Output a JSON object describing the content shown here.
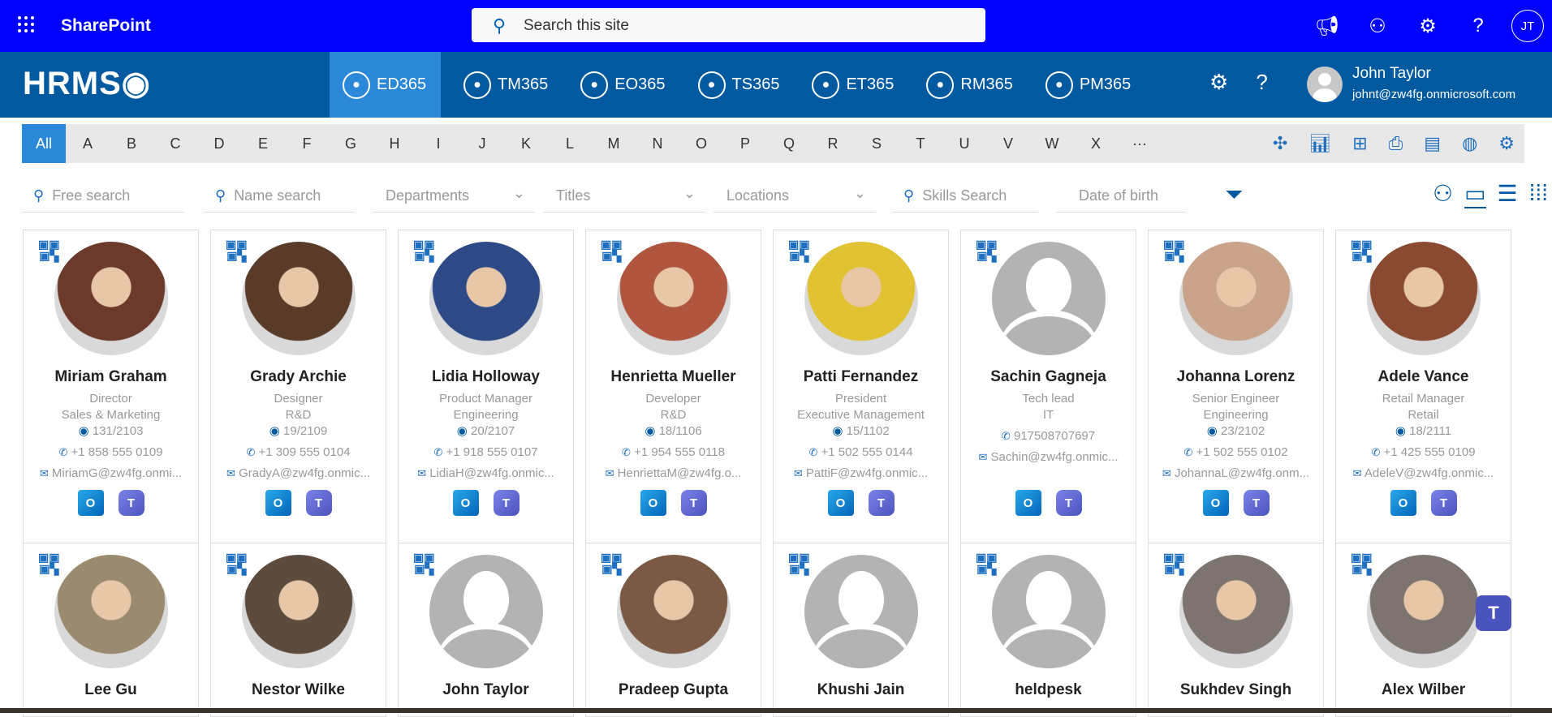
{
  "topbar": {
    "app_name": "SharePoint",
    "search_placeholder": "Search this site",
    "avatar_initials": "JT"
  },
  "hrms": {
    "logo": "HRMS",
    "apps": [
      {
        "label": "ED365",
        "icon": "directory-icon",
        "active": true
      },
      {
        "label": "TM365",
        "icon": "calendar-icon"
      },
      {
        "label": "EO365",
        "icon": "onboarding-icon"
      },
      {
        "label": "TS365",
        "icon": "clock-icon"
      },
      {
        "label": "ET365",
        "icon": "expense-icon"
      },
      {
        "label": "RM365",
        "icon": "person-icon"
      },
      {
        "label": "PM365",
        "icon": "performance-icon"
      }
    ],
    "user": {
      "name": "John Taylor",
      "email": "johnt@zw4fg.onmicrosoft.com"
    }
  },
  "alphabet": [
    "All",
    "A",
    "B",
    "C",
    "D",
    "E",
    "F",
    "G",
    "H",
    "I",
    "J",
    "K",
    "L",
    "M",
    "N",
    "O",
    "P",
    "Q",
    "R",
    "S",
    "T",
    "U",
    "V",
    "W",
    "X",
    "···"
  ],
  "filters": {
    "free_search": "Free search",
    "name_search": "Name search",
    "departments": "Departments",
    "titles": "Titles",
    "locations": "Locations",
    "skills": "Skills Search",
    "dob": "Date of birth"
  },
  "employees": [
    {
      "name": "Miriam Graham",
      "title": "Director",
      "dept": "Sales & Marketing",
      "office": "131/2103",
      "phone": "+1 858 555 0109",
      "email": "MiriamG@zw4fg.onmi...",
      "photo": "#6b3a2a"
    },
    {
      "name": "Grady Archie",
      "title": "Designer",
      "dept": "R&D",
      "office": "19/2109",
      "phone": "+1 309 555 0104",
      "email": "GradyA@zw4fg.onmic...",
      "photo": "#5a3b2a"
    },
    {
      "name": "Lidia Holloway",
      "title": "Product Manager",
      "dept": "Engineering",
      "office": "20/2107",
      "phone": "+1 918 555 0107",
      "email": "LidiaH@zw4fg.onmic...",
      "photo": "#2d4a86"
    },
    {
      "name": "Henrietta Mueller",
      "title": "Developer",
      "dept": "R&D",
      "office": "18/1106",
      "phone": "+1 954 555 0118",
      "email": "HenriettaM@zw4fg.o...",
      "photo": "#b0553e"
    },
    {
      "name": "Patti Fernandez",
      "title": "President",
      "dept": "Executive Management",
      "office": "15/1102",
      "phone": "+1 502 555 0144",
      "email": "PattiF@zw4fg.onmic...",
      "photo": "#e1c233"
    },
    {
      "name": "Sachin Gagneja",
      "title": "Tech lead",
      "dept": "IT",
      "office": "",
      "phone": "917508707697",
      "email": "Sachin@zw4fg.onmic...",
      "photo": ""
    },
    {
      "name": "Johanna Lorenz",
      "title": "Senior Engineer",
      "dept": "Engineering",
      "office": "23/2102",
      "phone": "+1 502 555 0102",
      "email": "JohannaL@zw4fg.onm...",
      "photo": "#c9a38a"
    },
    {
      "name": "Adele Vance",
      "title": "Retail Manager",
      "dept": "Retail",
      "office": "18/2111",
      "phone": "+1 425 555 0109",
      "email": "AdeleV@zw4fg.onmic...",
      "photo": "#8a4a32"
    },
    {
      "name": "Lee Gu",
      "photo": "#9a8a70"
    },
    {
      "name": "Nestor Wilke",
      "photo": "#5c4a3c"
    },
    {
      "name": "John Taylor",
      "photo": ""
    },
    {
      "name": "Pradeep Gupta",
      "photo": "#7a5a45"
    },
    {
      "name": "Khushi Jain",
      "photo": ""
    },
    {
      "name": "heldpesk",
      "photo": ""
    },
    {
      "name": "Sukhdev Singh",
      "photo": "#7d7470"
    },
    {
      "name": "Alex Wilber",
      "photo": "#7d7470"
    }
  ],
  "app_icons": {
    "outlook": "O",
    "teams": "T"
  }
}
